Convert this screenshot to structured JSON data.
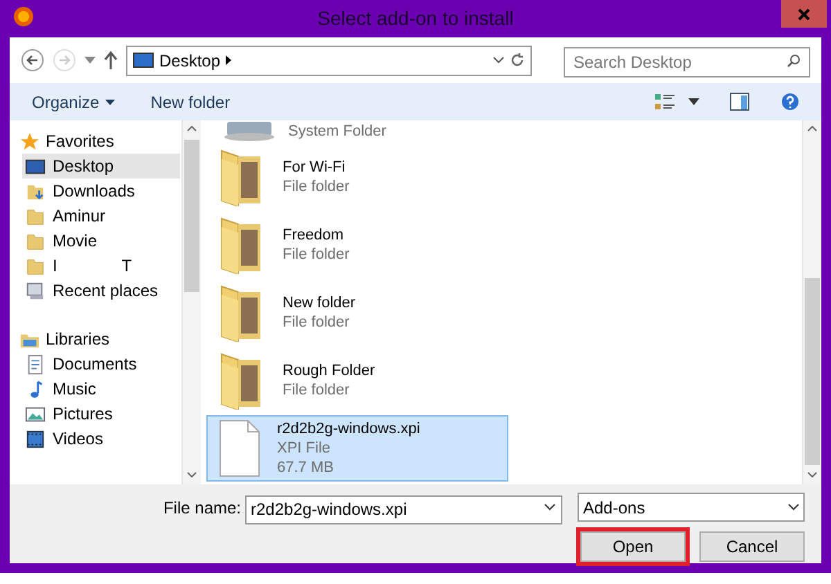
{
  "window": {
    "title": "Select add-on to install"
  },
  "address": {
    "location": "Desktop"
  },
  "search": {
    "placeholder": "Search Desktop"
  },
  "toolbar": {
    "organize": "Organize",
    "new_folder": "New folder"
  },
  "sidebar": {
    "groups": [
      {
        "label": "Favorites",
        "kind": "star",
        "children": [
          {
            "label": "Desktop",
            "kind": "desktop",
            "selected": true
          },
          {
            "label": "Downloads",
            "kind": "download",
            "selected": false
          },
          {
            "label": "Aminur",
            "kind": "folder",
            "selected": false
          },
          {
            "label": "Movie",
            "kind": "folder",
            "selected": false
          },
          {
            "label": "I              T",
            "kind": "folder",
            "selected": false
          },
          {
            "label": "Recent places",
            "kind": "recent",
            "selected": false
          }
        ]
      },
      {
        "label": "Libraries",
        "kind": "library",
        "children": [
          {
            "label": "Documents",
            "kind": "document",
            "selected": false
          },
          {
            "label": "Music",
            "kind": "music",
            "selected": false
          },
          {
            "label": "Pictures",
            "kind": "picture",
            "selected": false
          },
          {
            "label": "Videos",
            "kind": "video",
            "selected": false
          }
        ]
      }
    ]
  },
  "files": [
    {
      "kind": "system",
      "type": "System Folder",
      "selected": false
    },
    {
      "kind": "folder",
      "name": "For Wi-Fi",
      "type": "File folder",
      "selected": false
    },
    {
      "kind": "folder",
      "name": "Freedom",
      "type": "File folder",
      "selected": false
    },
    {
      "kind": "folder",
      "name": "New folder",
      "type": "File folder",
      "selected": false
    },
    {
      "kind": "folder",
      "name": "Rough Folder",
      "type": "File folder",
      "selected": false
    },
    {
      "kind": "file",
      "name": "r2d2b2g-windows.xpi",
      "type": "XPI File",
      "size": "67.7 MB",
      "selected": true
    }
  ],
  "footer": {
    "file_name_label": "File name:",
    "file_name": "r2d2b2g-windows.xpi",
    "filter": "Add-ons",
    "buttons": [
      {
        "label": "Open",
        "highlighted": true
      },
      {
        "label": "Cancel",
        "highlighted": false
      }
    ]
  }
}
